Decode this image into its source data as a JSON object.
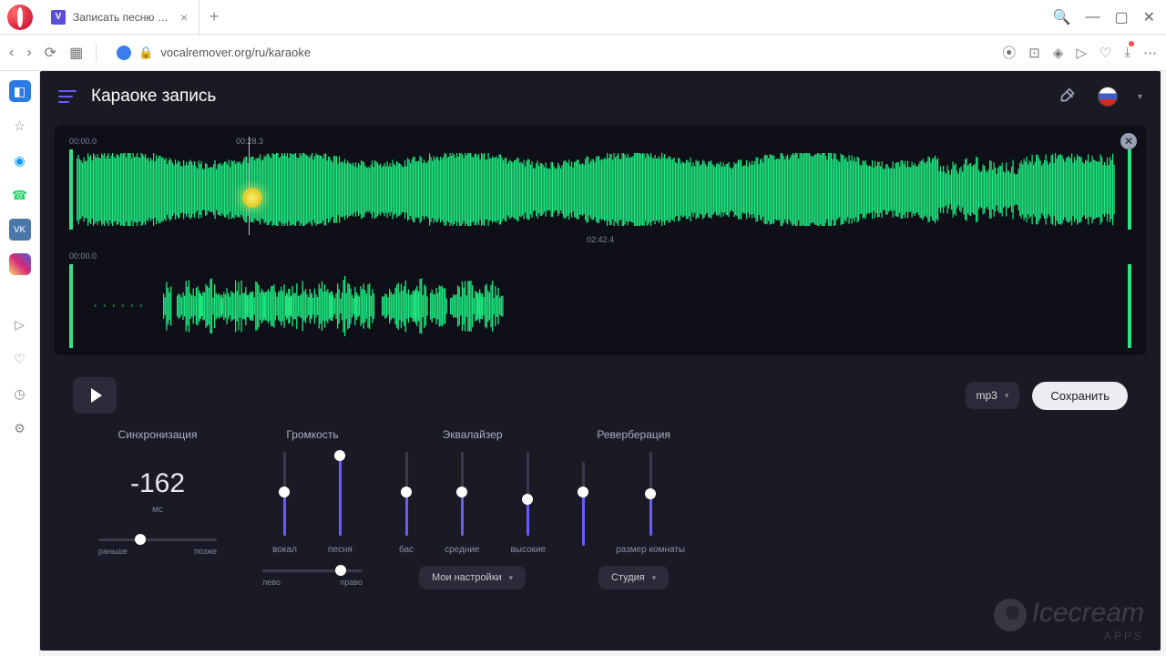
{
  "browser": {
    "tab_title": "Записать песню – караок",
    "tab_favicon_letter": "V",
    "url": "vocalremover.org/ru/karaoke"
  },
  "app": {
    "title": "Караоке запись"
  },
  "timeline": {
    "track1_start": "00:00.0",
    "playhead_ts": "00:28.3",
    "mid_ts": "02:42.4",
    "track2_start": "00:00.0"
  },
  "controls": {
    "format": "mp3",
    "save_label": "Сохранить"
  },
  "panels": {
    "sync": {
      "title": "Синхронизация",
      "value": "-162",
      "unit": "мс",
      "left_label": "раньше",
      "right_label": "позже",
      "thumb_pct": 35
    },
    "volume": {
      "title": "Громкость",
      "sliders": [
        {
          "label": "вокал",
          "value_pct": 52
        },
        {
          "label": "песня",
          "value_pct": 96
        }
      ],
      "balance_left": "лево",
      "balance_right": "право",
      "balance_pct": 78
    },
    "eq": {
      "title": "Эквалайзер",
      "sliders": [
        {
          "label": "бас",
          "value_pct": 52
        },
        {
          "label": "средние",
          "value_pct": 52
        },
        {
          "label": "высокие",
          "value_pct": 44
        }
      ],
      "preset_label": "Мои настройки"
    },
    "reverb": {
      "title": "Реверберация",
      "sliders": [
        {
          "label": "",
          "value_pct": 64
        },
        {
          "label": "размер комнаты",
          "value_pct": 50
        }
      ],
      "preset_label": "Студия"
    }
  },
  "watermark": {
    "brand": "Icecream",
    "sub": "APPS"
  }
}
